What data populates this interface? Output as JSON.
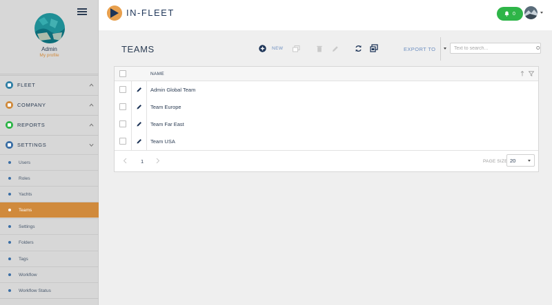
{
  "app": {
    "logo_text": "IN-FLEET",
    "notification_count": "0",
    "brand_color": "#1e3558",
    "accent_color": "#d08a3c"
  },
  "sidebar": {
    "profile_name": "Admin",
    "profile_link": "My profile",
    "sections": [
      {
        "label": "FLEET",
        "icon": "ship-icon",
        "color": "#2f7fa6"
      },
      {
        "label": "COMPANY",
        "icon": "building-icon",
        "color": "#d08a3c"
      },
      {
        "label": "REPORTS",
        "icon": "bar-chart-icon",
        "color": "#2eb548"
      },
      {
        "label": "SETTINGS",
        "icon": "gear-icon",
        "color": "#3a6ea5"
      }
    ],
    "items": [
      {
        "label": "Users"
      },
      {
        "label": "Roles"
      },
      {
        "label": "Yachts"
      },
      {
        "label": "Teams",
        "active": true
      },
      {
        "label": "Settings"
      },
      {
        "label": "Folders"
      },
      {
        "label": "Tags"
      },
      {
        "label": "Workflow"
      },
      {
        "label": "Workflow Status"
      }
    ]
  },
  "toolbar": {
    "title": "TEAMS",
    "new_label": "NEW",
    "export_label": "EXPORT TO",
    "search_placeholder": "Text to search..."
  },
  "grid": {
    "column_name": "NAME",
    "rows": [
      {
        "name": "Admin Global Team"
      },
      {
        "name": "Team Europe"
      },
      {
        "name": "Team Far East"
      },
      {
        "name": "Team USA"
      }
    ],
    "page": "1",
    "page_size_label": "PAGE SIZE",
    "page_size": "20"
  }
}
